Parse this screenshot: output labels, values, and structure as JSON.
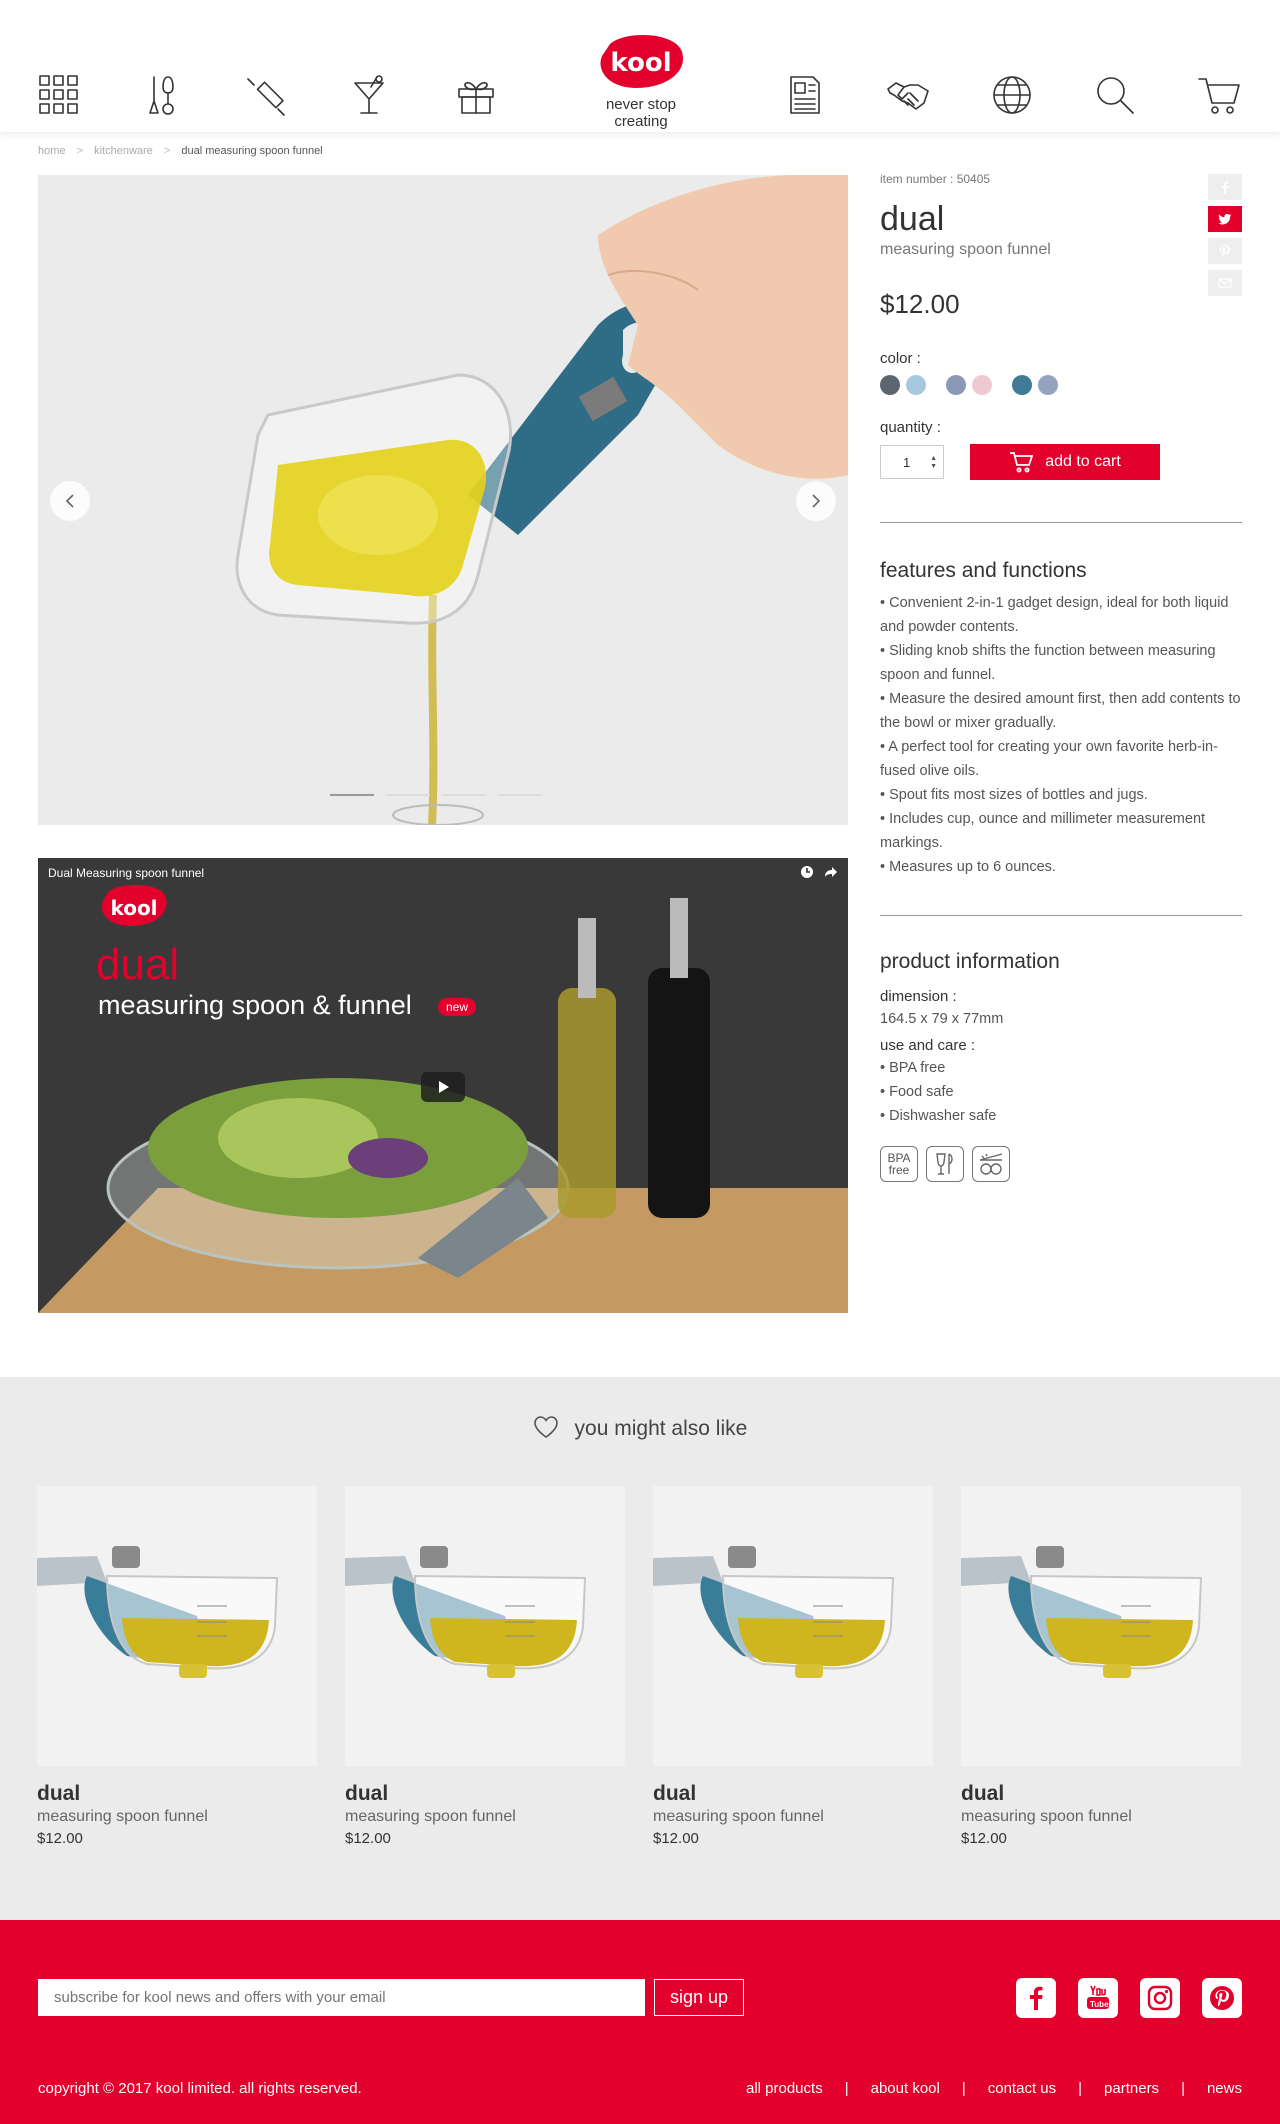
{
  "header": {
    "logo_text": "kool",
    "tagline": "never stop creating",
    "nav_left": [
      "grid-icon",
      "utensils-icon",
      "rolling-pin-icon",
      "cocktail-icon",
      "gift-icon"
    ],
    "nav_right": [
      "catalog-icon",
      "handshake-icon",
      "globe-icon",
      "search-icon",
      "cart-icon"
    ]
  },
  "breadcrumb": {
    "items": [
      "home",
      "kitchenware"
    ],
    "separator": ">",
    "current": "dual measuring spoon funnel"
  },
  "gallery": {
    "slides_count": 4,
    "active_slide": 1
  },
  "video": {
    "title": "Dual Measuring spoon funnel",
    "logo_text": "kool",
    "headline": "dual",
    "subheadline": "measuring spoon & funnel",
    "badge": "new"
  },
  "product": {
    "item_number": "item number : 50405",
    "title": "dual",
    "subtitle": "measuring spoon funnel",
    "price": "$12.00",
    "color_label": "color :",
    "color_pairs": [
      [
        "#5c6670",
        "#a7c9e0"
      ],
      [
        "#8a9ab6",
        "#efc9d0"
      ],
      [
        "#3f7a97",
        "#95a3bf"
      ]
    ],
    "quantity_label": "quantity :",
    "quantity_value": "1",
    "add_to_cart_label": "add to cart"
  },
  "features": {
    "heading": "features and functions",
    "items": [
      "• Convenient 2-in-1 gadget design, ideal for both liquid and powder contents.",
      "• Sliding knob shifts the function between measuring spoon and funnel.",
      "• Measure the desired amount first, then add contents to the bowl or mixer gradually.",
      "• A perfect tool for creating your own favorite herb-in-fused olive oils.",
      "• Spout fits most sizes of bottles and jugs.",
      "• Includes cup, ounce and millimeter measurement markings.",
      "• Measures up to 6 ounces."
    ]
  },
  "product_information": {
    "heading": "product information",
    "dimension_label": "dimension :",
    "dimension_value": "164.5 x 79 x 77mm",
    "care_label": "use and care :",
    "care_items": [
      "• BPA free",
      "• Food safe",
      "• Dishwasher safe"
    ],
    "cert_bpa_line1": "BPA",
    "cert_bpa_line2": "free",
    "cert_icons": [
      "bpa-free-icon",
      "food-safe-icon",
      "dishwasher-safe-icon"
    ]
  },
  "social_share": [
    "facebook-icon",
    "twitter-icon",
    "pinterest-icon",
    "email-icon"
  ],
  "recommended": {
    "heading": "you might also like",
    "cards": [
      {
        "title": "dual",
        "subtitle": "measuring spoon funnel",
        "price": "$12.00"
      },
      {
        "title": "dual",
        "subtitle": "measuring spoon funnel",
        "price": "$12.00"
      },
      {
        "title": "dual",
        "subtitle": "measuring spoon funnel",
        "price": "$12.00"
      },
      {
        "title": "dual",
        "subtitle": "measuring spoon funnel",
        "price": "$12.00"
      }
    ]
  },
  "footer": {
    "subscribe_placeholder": "subscribe for kool news and offers with your email",
    "signup_label": "sign up",
    "social": [
      "facebook-icon",
      "youtube-icon",
      "instagram-icon",
      "pinterest-icon"
    ],
    "copyright": "copyright © 2017 kool limited. all rights reserved.",
    "links": [
      "all products",
      "about kool",
      "contact us",
      "partners",
      "news"
    ]
  },
  "colors": {
    "brand_red": "#e3002c",
    "light_gray_bg": "#ebebeb",
    "text_dark": "#333333"
  }
}
